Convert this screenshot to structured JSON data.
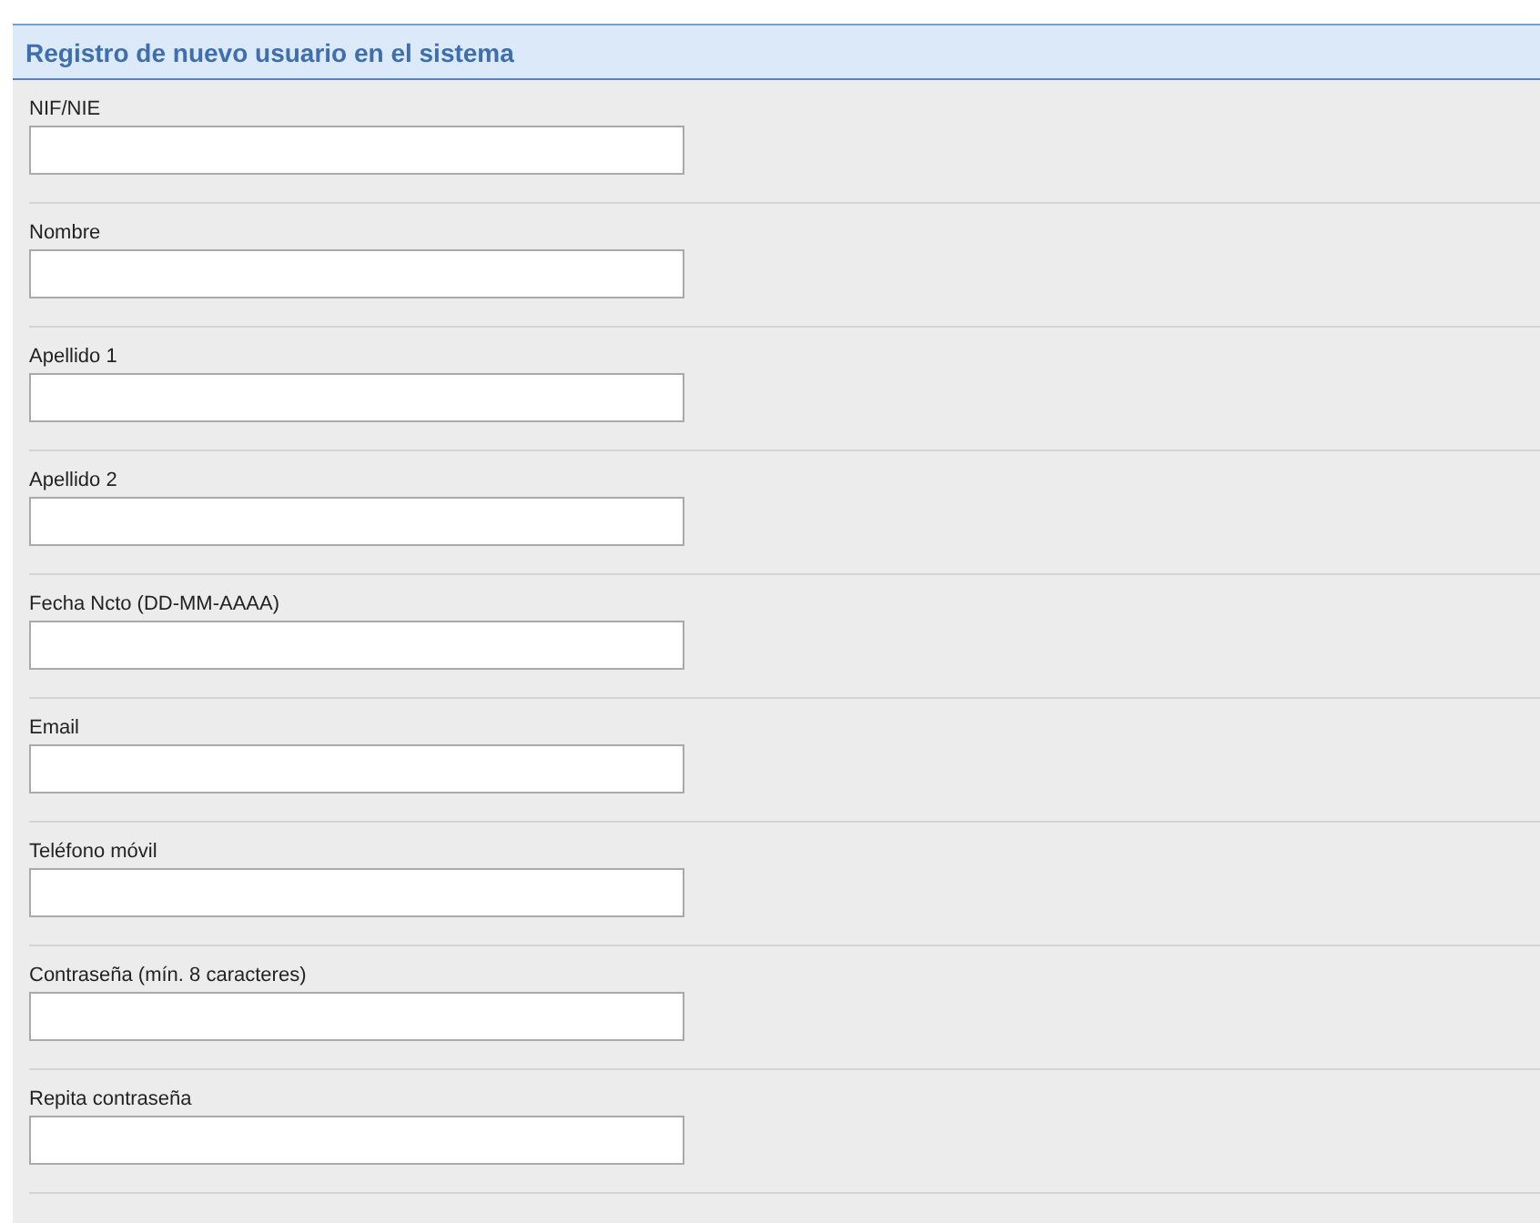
{
  "form": {
    "title": "Registro de nuevo usuario en el sistema",
    "fields": [
      {
        "label": "NIF/NIE"
      },
      {
        "label": "Nombre"
      },
      {
        "label": "Apellido 1"
      },
      {
        "label": "Apellido 2"
      },
      {
        "label": "Fecha Ncto (DD-MM-AAAA)"
      },
      {
        "label": "Email"
      },
      {
        "label": "Teléfono móvil"
      },
      {
        "label": "Contraseña (mín. 8 caracteres)"
      },
      {
        "label": "Repita contraseña"
      }
    ]
  }
}
